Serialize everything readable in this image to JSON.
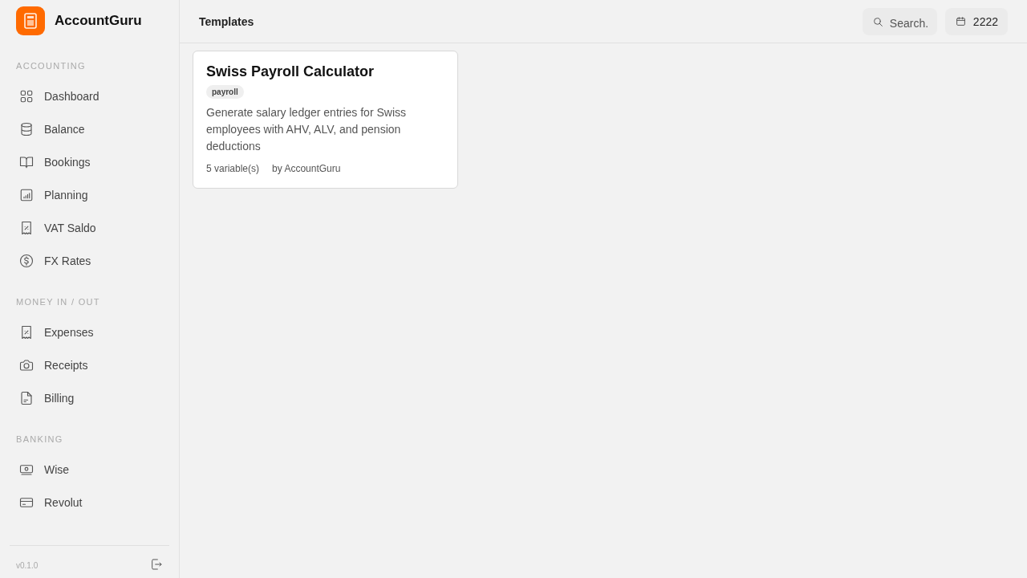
{
  "app": {
    "name": "AccountGuru"
  },
  "sidebar": {
    "sections": [
      {
        "title": "ACCOUNTING",
        "items": [
          {
            "label": "Dashboard"
          },
          {
            "label": "Balance"
          },
          {
            "label": "Bookings"
          },
          {
            "label": "Planning"
          },
          {
            "label": "VAT Saldo"
          },
          {
            "label": "FX Rates"
          }
        ]
      },
      {
        "title": "MONEY IN / OUT",
        "items": [
          {
            "label": "Expenses"
          },
          {
            "label": "Receipts"
          },
          {
            "label": "Billing"
          }
        ]
      },
      {
        "title": "BANKING",
        "items": [
          {
            "label": "Wise"
          },
          {
            "label": "Revolut"
          }
        ]
      }
    ],
    "version": "v0.1.0"
  },
  "header": {
    "title": "Templates",
    "search": {
      "placeholder": "Search."
    },
    "year": "2222"
  },
  "templates": [
    {
      "title": "Swiss Payroll Calculator",
      "tag": "payroll",
      "description": "Generate salary ledger entries for Swiss employees with AHV, ALV, and pension deductions",
      "variables": "5 variable(s)",
      "author": "by AccountGuru"
    }
  ]
}
